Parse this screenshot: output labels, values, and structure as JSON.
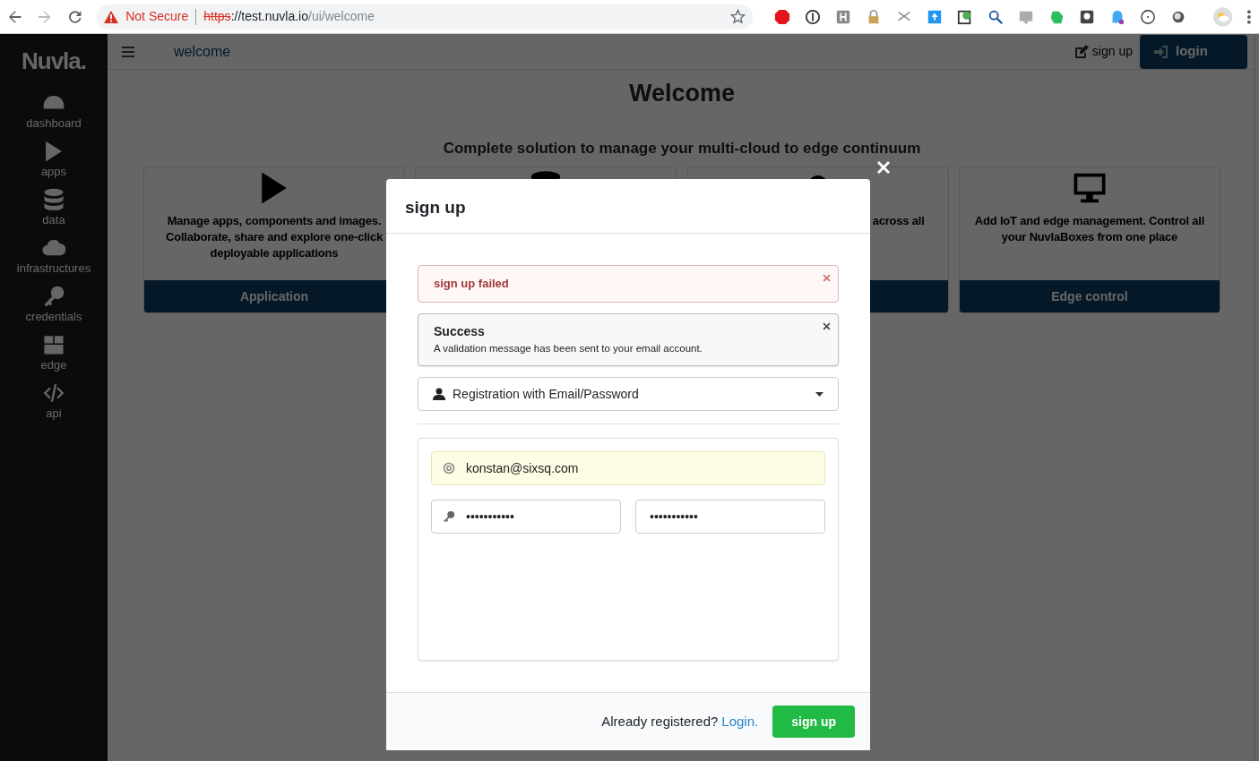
{
  "browser": {
    "security_label": "Not Secure",
    "url_scheme": "https",
    "url_host": "://test.nuvla.io",
    "url_path": "/ui/welcome"
  },
  "sidebar": {
    "logo": "Nuvla.",
    "items": [
      {
        "kind": "dashboard",
        "label": "dashboard"
      },
      {
        "kind": "play",
        "label": "apps"
      },
      {
        "kind": "database",
        "label": "data"
      },
      {
        "kind": "cloud",
        "label": "infrastructures"
      },
      {
        "kind": "key",
        "label": "credentials"
      },
      {
        "kind": "box",
        "label": "edge"
      },
      {
        "kind": "code",
        "label": "api"
      }
    ]
  },
  "topbar": {
    "breadcrumb": "welcome",
    "signup_link": "sign up",
    "login_button": "login"
  },
  "page": {
    "title": "Welcome",
    "subtitle": "Complete solution to manage your multi-cloud to edge continuum",
    "cards": [
      {
        "kind": "play",
        "text": "Manage apps, components and images. Collaborate, share and explore one-click deployable applications",
        "button": "Application"
      },
      {
        "kind": "database"
      },
      {
        "kind": "cloud",
        "text": "across all"
      },
      {
        "kind": "monitor",
        "text": "Add IoT and edge management. Control all your NuvlaBoxes from one place",
        "button": "Edge control"
      }
    ]
  },
  "modal": {
    "title": "sign up",
    "alerts": [
      {
        "kind": "error",
        "title": "sign up failed"
      },
      {
        "kind": "info",
        "title": "Success",
        "message": "A validation message has been sent to your email account."
      }
    ],
    "method": "Registration with Email/Password",
    "email": "konstan@sixsq.com",
    "password": "•••••••••••",
    "password_repeat": "•••••••••••",
    "footer_text": "Already registered?",
    "footer_link": "Login.",
    "submit": "sign up"
  }
}
